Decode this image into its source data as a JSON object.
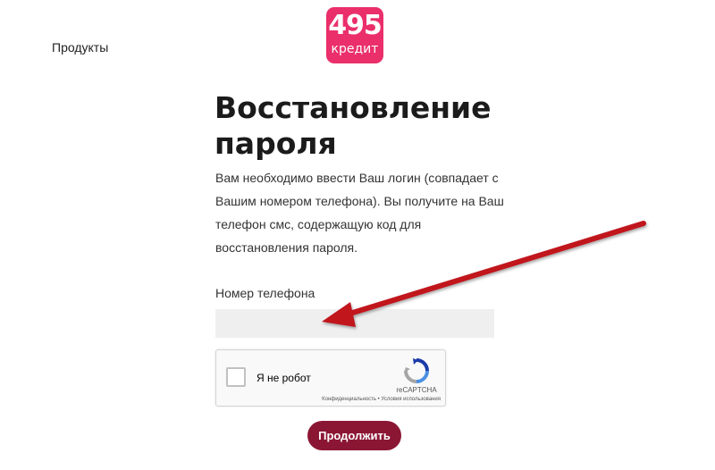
{
  "nav": {
    "products_label": "Продукты"
  },
  "logo": {
    "number": "495",
    "word": "кредит"
  },
  "page": {
    "title": "Восстановление пароля",
    "description": "Вам необходимо ввести Ваш логин (совпадает с Вашим номером телефона). Вы получите на Ваш телефон смс, содержащую код для восстановления пароля."
  },
  "form": {
    "phone_label": "Номер телефона",
    "phone_value": "",
    "phone_placeholder": "",
    "submit_label": "Продолжить"
  },
  "captcha": {
    "checkbox_label": "Я не робот",
    "brand": "reCAPTCHA",
    "links": "Конфиденциальность • Условия использования"
  },
  "colors": {
    "logo_bg": "#ea2f6a",
    "button_bg": "#8b1634",
    "input_bg": "#efefef",
    "annotation_arrow": "#c0121e"
  }
}
